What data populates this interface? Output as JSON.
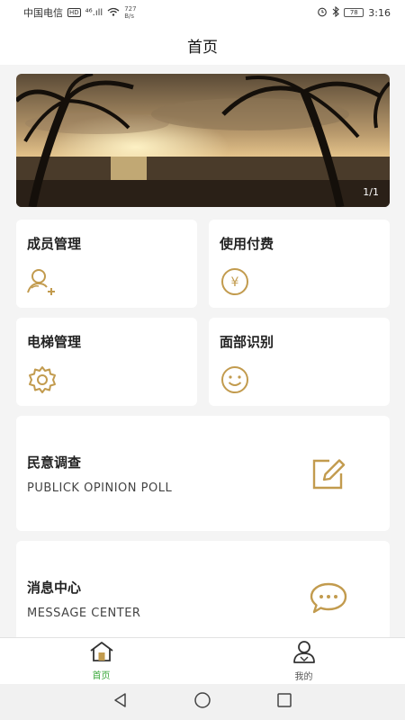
{
  "status_bar": {
    "carrier": "中国电信",
    "hd": "HD",
    "signal": "⁴⁶.ıll",
    "net_speed_value": "727",
    "net_speed_unit": "B/s",
    "battery": "78",
    "time": "3:16"
  },
  "header": {
    "title": "首页"
  },
  "banner": {
    "indicator": "1/1"
  },
  "cards": {
    "members": {
      "title": "成员管理",
      "icon": "add-user-icon"
    },
    "payment": {
      "title": "使用付费",
      "icon": "yen-coin-icon"
    },
    "elevator": {
      "title": "电梯管理",
      "icon": "gear-icon"
    },
    "face": {
      "title": "面部识别",
      "icon": "smile-face-icon"
    }
  },
  "wide_cards": {
    "poll": {
      "title": "民意调查",
      "subtitle": "PUBLICK OPINION POLL",
      "icon": "edit-icon"
    },
    "messages": {
      "title": "消息中心",
      "subtitle": "MESSAGE CENTER",
      "icon": "chat-bubble-icon"
    }
  },
  "tabbar": {
    "home": {
      "label": "首页",
      "icon": "home-icon"
    },
    "mine": {
      "label": "我的",
      "icon": "profile-icon"
    }
  },
  "colors": {
    "accent_gold": "#c29b4e",
    "active_tab": "#3aa83a",
    "page_bg": "#f4f4f4"
  }
}
